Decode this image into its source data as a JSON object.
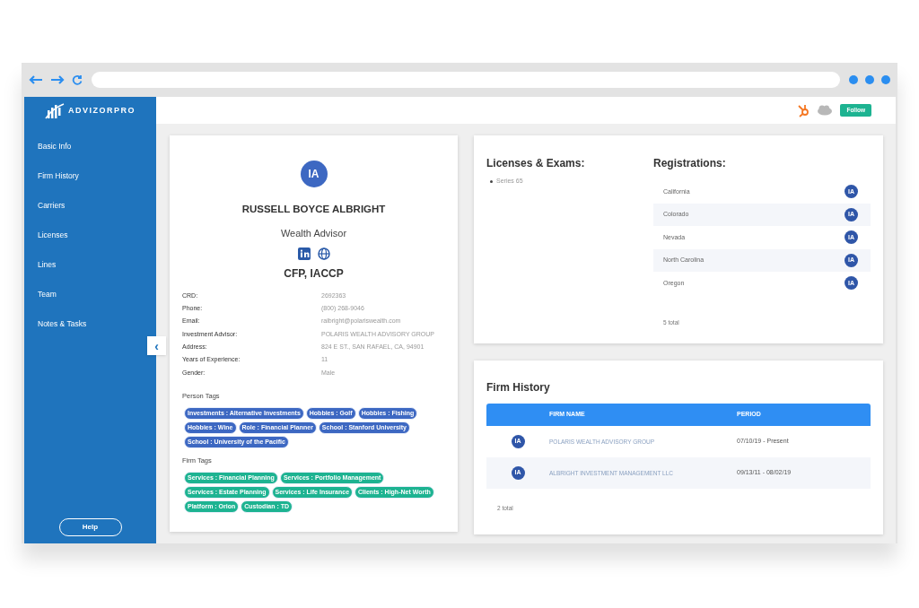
{
  "logo": {
    "text": "ADVIZORPRO"
  },
  "sidebar": {
    "items": [
      {
        "label": "Basic Info"
      },
      {
        "label": "Firm History"
      },
      {
        "label": "Carriers"
      },
      {
        "label": "Licenses"
      },
      {
        "label": "Lines"
      },
      {
        "label": "Team"
      },
      {
        "label": "Notes & Tasks"
      }
    ],
    "help_button": "Help",
    "collapse_button": "‹"
  },
  "header": {
    "follow_button": "Follow"
  },
  "profile": {
    "avatar": "IA",
    "name": "RUSSELL BOYCE ALBRIGHT",
    "title": "Wealth Advisor",
    "designations": "CFP, IACCP",
    "details": [
      {
        "label": "CRD:",
        "value": "2692363"
      },
      {
        "label": "Phone:",
        "value": "(800) 268-9046"
      },
      {
        "label": "Email:",
        "value": "ralbright@polariswealth.com"
      },
      {
        "label": "Investment Advisor:",
        "value": "POLARIS WEALTH ADVISORY GROUP"
      },
      {
        "label": "Address:",
        "value": "824 E ST., SAN RAFAEL, CA, 94901"
      },
      {
        "label": "Years of Experience:",
        "value": "11"
      },
      {
        "label": "Gender:",
        "value": "Male"
      }
    ],
    "tag_groups": [
      {
        "title": "Person Tags",
        "color": "#3d68c2",
        "tags": [
          "Investments : Alternative Investments",
          "Hobbies : Golf",
          "Hobbies : Fishing",
          "Hobbies : Wine",
          "Role : Financial Planner",
          "School : Stanford University",
          "School : University of the Pacific"
        ]
      },
      {
        "title": "Firm Tags",
        "color": "#1db391",
        "tags": [
          "Services : Financial Planning",
          "Services : Portfolio Management",
          "Services : Estate Planning",
          "Services : Life Insurance",
          "Clients : High-Net Worth",
          "Platform : Orion",
          "Custodian : TD"
        ]
      }
    ]
  },
  "licenses": {
    "title": "Licenses & Exams:",
    "items": [
      "Series 65"
    ]
  },
  "registrations": {
    "title": "Registrations:",
    "rows": [
      {
        "state": "California",
        "badge": "IA"
      },
      {
        "state": "Colorado",
        "badge": "IA"
      },
      {
        "state": "Nevada",
        "badge": "IA"
      },
      {
        "state": "North Carolina",
        "badge": "IA"
      },
      {
        "state": "Oregon",
        "badge": "IA"
      }
    ],
    "total": "5 total"
  },
  "firm_history": {
    "title": "Firm History",
    "columns": [
      "FIRM NAME",
      "PERIOD"
    ],
    "rows": [
      {
        "badge": "IA",
        "firm": "POLARIS WEALTH ADVISORY GROUP",
        "period": "07/10/19 - Present"
      },
      {
        "badge": "IA",
        "firm": "ALBRIGHT INVESTMENT MANAGEMENT LLC",
        "period": "09/13/11 - 08/02/19"
      }
    ],
    "total": "2 total"
  }
}
